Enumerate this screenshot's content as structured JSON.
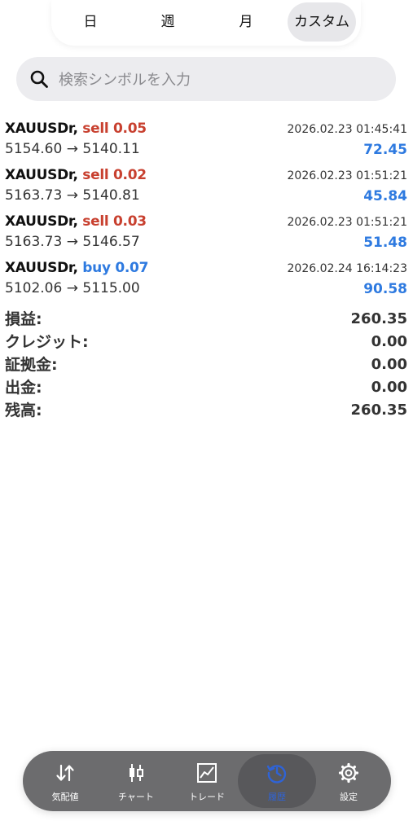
{
  "periods": [
    "日",
    "週",
    "月",
    "カスタム"
  ],
  "active_period": "カスタム",
  "search": {
    "placeholder": "検索シンボルを入力"
  },
  "trades": [
    {
      "symbol": "XAUUSDr,",
      "side": "sell",
      "volume": "0.05",
      "time": "2026.02.23 01:45:41",
      "open": "5154.60",
      "arrow": "→",
      "close": "5140.11",
      "profit": "72.45"
    },
    {
      "symbol": "XAUUSDr,",
      "side": "sell",
      "volume": "0.02",
      "time": "2026.02.23 01:51:21",
      "open": "5163.73",
      "arrow": "→",
      "close": "5140.81",
      "profit": "45.84"
    },
    {
      "symbol": "XAUUSDr,",
      "side": "sell",
      "volume": "0.03",
      "time": "2026.02.23 01:51:21",
      "open": "5163.73",
      "arrow": "→",
      "close": "5146.57",
      "profit": "51.48"
    },
    {
      "symbol": "XAUUSDr,",
      "side": "buy",
      "volume": "0.07",
      "time": "2026.02.24 16:14:23",
      "open": "5102.06",
      "arrow": "→",
      "close": "5115.00",
      "profit": "90.58"
    }
  ],
  "summary": [
    {
      "label": "損益:",
      "value": "260.35"
    },
    {
      "label": "クレジット:",
      "value": "0.00"
    },
    {
      "label": "証拠金:",
      "value": "0.00"
    },
    {
      "label": "出金:",
      "value": "0.00"
    },
    {
      "label": "残高:",
      "value": "260.35"
    }
  ],
  "tabbar": [
    {
      "label": "気配値",
      "icon": "quotes-arrows-icon"
    },
    {
      "label": "チャート",
      "icon": "candlestick-icon"
    },
    {
      "label": "トレード",
      "icon": "trade-chart-icon"
    },
    {
      "label": "履歴",
      "icon": "history-clock-icon"
    },
    {
      "label": "設定",
      "icon": "gear-icon"
    }
  ],
  "active_tab": "履歴",
  "colors": {
    "sell": "#c8402f",
    "buy": "#2e7ae0",
    "profit": "#2e7ae0",
    "active_tab": "#2f63d6"
  }
}
